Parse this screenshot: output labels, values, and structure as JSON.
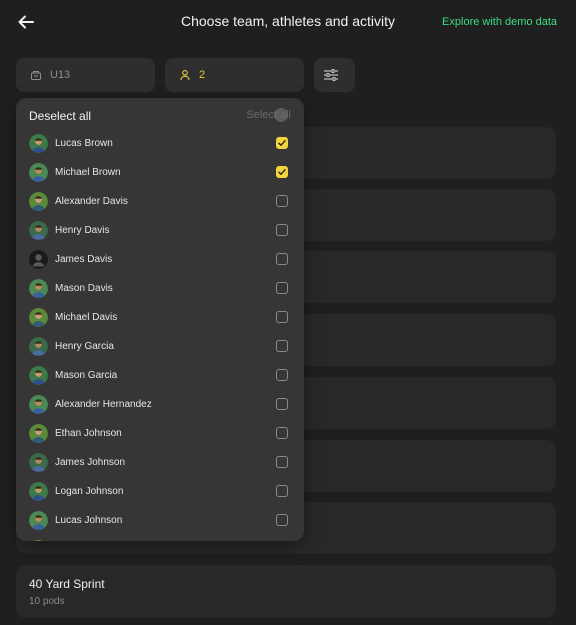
{
  "header": {
    "title": "Choose team, athletes and activity",
    "demo_link": "Explore with demo data"
  },
  "filters": {
    "team": "U13",
    "athletes_count": "2"
  },
  "dropdown": {
    "deselect_all": "Deselect all",
    "select_all": "Select all",
    "athletes": [
      {
        "name": "Lucas Brown",
        "checked": true,
        "avatar": "photo"
      },
      {
        "name": "Michael Brown",
        "checked": true,
        "avatar": "photo"
      },
      {
        "name": "Alexander Davis",
        "checked": false,
        "avatar": "photo"
      },
      {
        "name": "Henry Davis",
        "checked": false,
        "avatar": "photo"
      },
      {
        "name": "James Davis",
        "checked": false,
        "avatar": "placeholder"
      },
      {
        "name": "Mason Davis",
        "checked": false,
        "avatar": "photo"
      },
      {
        "name": "Michael Davis",
        "checked": false,
        "avatar": "photo"
      },
      {
        "name": "Henry Garcia",
        "checked": false,
        "avatar": "photo"
      },
      {
        "name": "Mason Garcia",
        "checked": false,
        "avatar": "photo"
      },
      {
        "name": "Alexander Hernandez",
        "checked": false,
        "avatar": "photo"
      },
      {
        "name": "Ethan Johnson",
        "checked": false,
        "avatar": "photo"
      },
      {
        "name": "James Johnson",
        "checked": false,
        "avatar": "photo"
      },
      {
        "name": "Logan Johnson",
        "checked": false,
        "avatar": "photo"
      },
      {
        "name": "Lucas Johnson",
        "checked": false,
        "avatar": "photo"
      },
      {
        "name": "",
        "checked": false,
        "avatar": "photo"
      }
    ]
  },
  "activity": {
    "name": "40 Yard Sprint",
    "subtitle": "10 pods"
  },
  "colors": {
    "accent_green": "#3ddc84",
    "accent_yellow": "#f2d43c"
  }
}
